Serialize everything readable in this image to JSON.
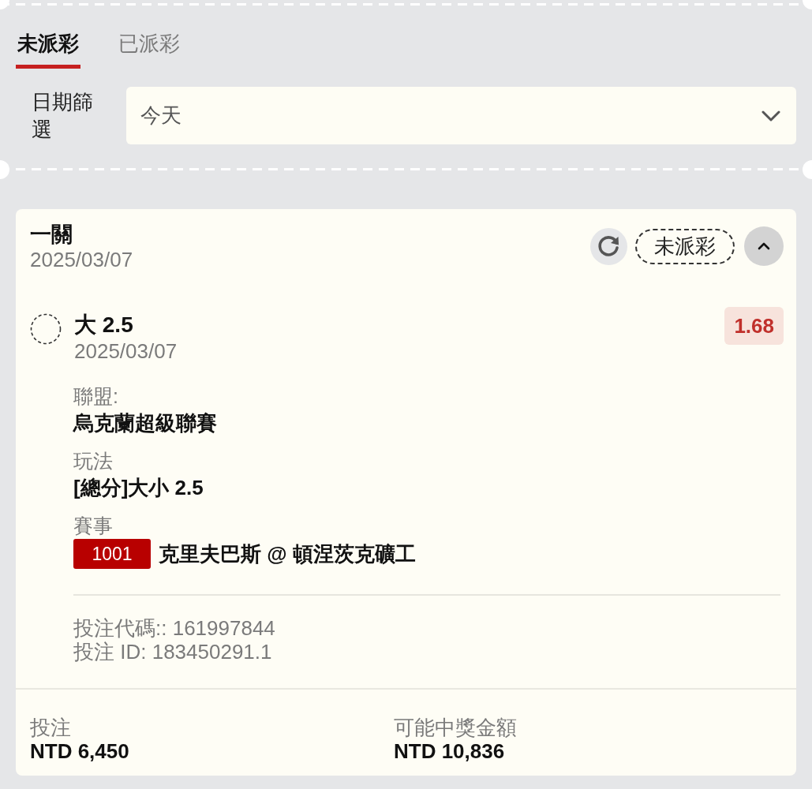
{
  "tabs": [
    {
      "label": "未派彩",
      "selected": true
    },
    {
      "label": "已派彩",
      "selected": false
    }
  ],
  "date_filter": {
    "label": "日期篩選",
    "value": "今天"
  },
  "bet_card": {
    "title": "一關",
    "date": "2025/03/07",
    "status": "未派彩",
    "expanded": true,
    "selections": [
      {
        "pick": "大 2.5",
        "date": "2025/03/07",
        "odds": "1.68",
        "details": [
          {
            "kind": "text",
            "label": "聯盟:",
            "value": "烏克蘭超級聯賽"
          },
          {
            "kind": "text",
            "label": "玩法",
            "value": "[總分]大小 2.5"
          },
          {
            "kind": "match",
            "label": "賽事",
            "code": "1001",
            "value": "克里夫巴斯 @ 頓涅茨克礦工"
          }
        ],
        "bet_code": "投注代碼:: 161997844",
        "bet_id": "投注 ID: 183450291.1"
      }
    ],
    "stake": {
      "label": "投注",
      "value": "NTD 6,450"
    },
    "potential_payout": {
      "label": "可能中獎金額",
      "value": "NTD 10,836"
    }
  }
}
